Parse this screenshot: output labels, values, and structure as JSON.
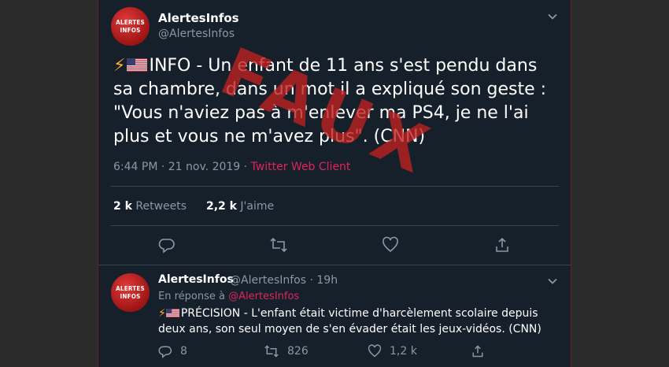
{
  "tweet": {
    "avatar_line1": "ALERTES",
    "avatar_line2": "INFOS",
    "name": "AlertesInfos",
    "handle": "@AlertesInfos",
    "text": "INFO - Un enfant de 11 ans s'est pendu dans sa chambre, dans un mot il a expliqué son geste : \"Vous n'aviez pas à m'enlever ma PS4, je ne l'ai plus et vous ne m'avez plus\". (CNN)",
    "watermark": "FAUX",
    "time_date": "6:44 PM · 21 nov. 2019 · ",
    "source": "Twitter Web Client",
    "retweets_count": "2 k",
    "retweets_label": "Retweets",
    "likes_count": "2,2 k",
    "likes_label": "J'aime"
  },
  "reply": {
    "name": "AlertesInfos",
    "handle": "@AlertesInfos",
    "time": "· 19h",
    "in_reply_prefix": "En réponse à",
    "in_reply_mention": "@AlertesInfos",
    "text": "PRÉCISION - L'enfant était victime d'harcèlement scolaire depuis deux ans, son seul moyen de s'en évader était les jeux-vidéos. (CNN)",
    "replies_count": "8",
    "retweets_count": "826",
    "likes_count": "1,2 k"
  },
  "colors": {
    "background": "#15202b",
    "accent": "#e0245e",
    "muted": "#8899a6",
    "watermark": "#c02020"
  }
}
